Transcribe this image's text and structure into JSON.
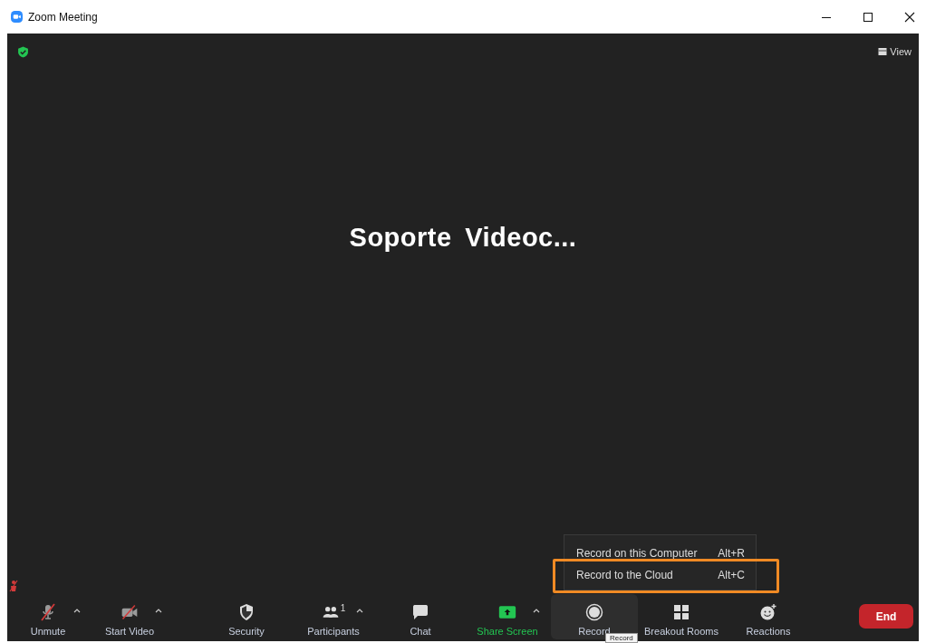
{
  "window": {
    "title": "Zoom Meeting"
  },
  "view_button": {
    "label": "View"
  },
  "meeting_name": "Soporte Videoc...",
  "toolbar": [
    {
      "kind": "mic",
      "label": "Unmute",
      "off": true,
      "has_menu": true,
      "selected": false
    },
    {
      "kind": "video",
      "label": "Start Video",
      "off": true,
      "has_menu": true,
      "selected": false
    },
    {
      "kind": "security",
      "label": "Security",
      "has_menu": false,
      "selected": false
    },
    {
      "kind": "participants",
      "label": "Participants",
      "count": "1",
      "has_menu": true,
      "selected": false
    },
    {
      "kind": "chat",
      "label": "Chat",
      "has_menu": false,
      "selected": false
    },
    {
      "kind": "share",
      "label": "Share Screen",
      "has_menu": true,
      "selected": false
    },
    {
      "kind": "record",
      "label": "Record",
      "has_menu": false,
      "selected": true
    },
    {
      "kind": "breakout",
      "label": "Breakout Rooms",
      "has_menu": false,
      "selected": false
    },
    {
      "kind": "reactions",
      "label": "Reactions",
      "has_menu": false,
      "selected": false
    }
  ],
  "end_button": {
    "label": "End"
  },
  "record_menu": [
    {
      "label": "Record on this Computer",
      "shortcut": "Alt+R",
      "highlighted": false
    },
    {
      "label": "Record to the Cloud",
      "shortcut": "Alt+C",
      "highlighted": true
    }
  ],
  "tooltip": "Record"
}
